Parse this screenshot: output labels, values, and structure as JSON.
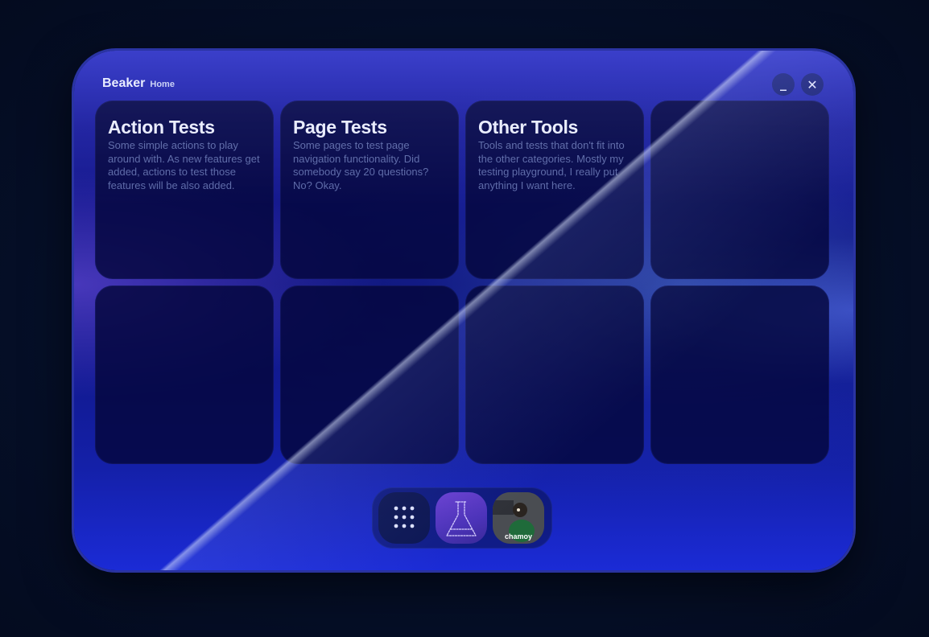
{
  "window": {
    "app_title": "Beaker",
    "breadcrumb": "Home",
    "minimize_label": "_",
    "close_label": "✕"
  },
  "tiles": [
    {
      "title": "Action Tests",
      "description": "Some simple actions to play around with. As new features get added, actions to test those features will be also added."
    },
    {
      "title": "Page Tests",
      "description": "Some pages to test page navigation functionality. Did somebody say 20 questions? No? Okay."
    },
    {
      "title": "Other Tools",
      "description": "Tools and tests that don't fit into the other categories. Mostly my testing playground, I really put anything I want here."
    },
    {
      "title": "",
      "description": ""
    },
    {
      "title": "",
      "description": ""
    },
    {
      "title": "",
      "description": ""
    },
    {
      "title": "",
      "description": ""
    },
    {
      "title": "",
      "description": ""
    }
  ],
  "dock": {
    "items": [
      {
        "icon": "app-grid-icon"
      },
      {
        "icon": "beaker-icon"
      },
      {
        "icon": "avatar",
        "label": "chamoy"
      }
    ]
  },
  "colors": {
    "window_blue": "#1a1d9e",
    "tile_bg": "#04063c",
    "title_text": "#e9ecff",
    "desc_text": "#5d6aa8",
    "beaker_purple": "#6a3fd0"
  }
}
